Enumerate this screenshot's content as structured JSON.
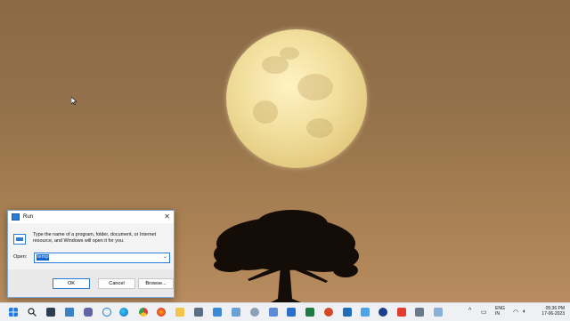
{
  "run_dialog": {
    "title": "Run",
    "description": "Type the name of a program, folder, document, or Internet resource, and Windows will open it for you.",
    "open_label": "Open:",
    "open_value": "temp",
    "buttons": {
      "ok": "OK",
      "cancel": "Cancel",
      "browse": "Browse..."
    }
  },
  "taskbar": {
    "icons": [
      "start-icon",
      "search-icon",
      "photos-icon",
      "task-view-icon",
      "teams-icon",
      "cortana-icon",
      "edge-icon",
      "chrome-icon",
      "firefox-icon",
      "file-explorer-icon",
      "calculator-icon",
      "notepad-icon",
      "control-panel-icon",
      "settings-icon",
      "snipping-tool-icon",
      "paint-icon",
      "outlook-icon",
      "excel-icon",
      "powerpoint-icon",
      "terminal-icon",
      "photos-app-icon",
      "t-app-icon",
      "anydesk-icon",
      "explorer-icon",
      "camera-icon"
    ],
    "language": {
      "line1": "ENG",
      "line2": "IN"
    },
    "time": "05:36 PM",
    "date": "17-06-2023"
  },
  "colors": {
    "accent": "#2b7bd8",
    "sky_top": "#8a6a45",
    "sky_bottom": "#b88c5e",
    "moon": "#f1de9c"
  }
}
